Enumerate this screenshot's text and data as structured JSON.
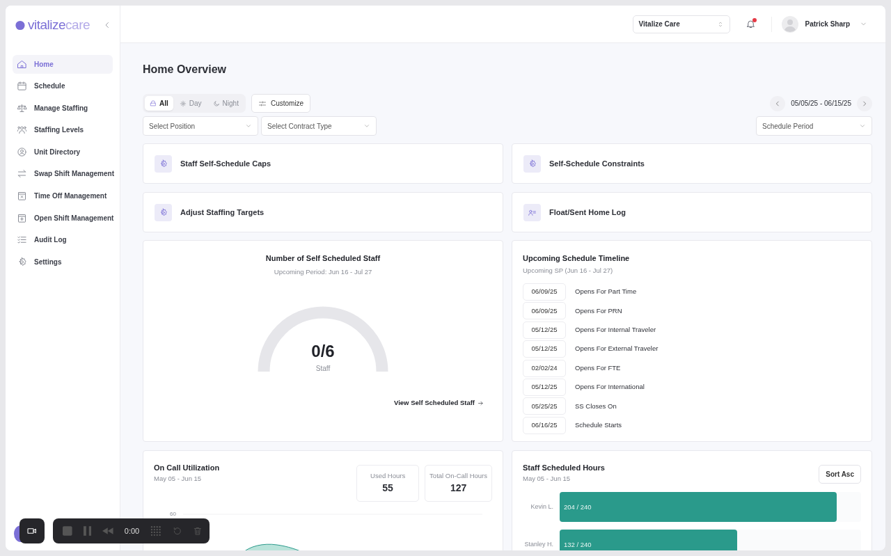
{
  "brand": {
    "name_part_1": "vitalize",
    "name_part_2": "care"
  },
  "sidebar": {
    "items": [
      {
        "label": "Home",
        "selected": true
      },
      {
        "label": "Schedule",
        "selected": false
      },
      {
        "label": "Manage Staffing",
        "selected": false
      },
      {
        "label": "Staffing Levels",
        "selected": false
      },
      {
        "label": "Unit Directory",
        "selected": false
      },
      {
        "label": "Swap Shift Management",
        "selected": false
      },
      {
        "label": "Time Off Management",
        "selected": false
      },
      {
        "label": "Open Shift Management",
        "selected": false
      },
      {
        "label": "Audit Log",
        "selected": false
      },
      {
        "label": "Settings",
        "selected": false
      }
    ]
  },
  "header": {
    "organization": "Vitalize Care",
    "notification_unread": true,
    "user_name": "Patrick Sharp"
  },
  "page_title": "Home Overview",
  "shift_tabs": [
    {
      "label": "All",
      "selected": true
    },
    {
      "label": "Day",
      "selected": false
    },
    {
      "label": "Night",
      "selected": false
    }
  ],
  "customize_button": "Customize",
  "date_range": "05/05/25 - 06/15/25",
  "filters": [
    {
      "placeholder": "Select Position"
    },
    {
      "placeholder": "Select Contract Type"
    }
  ],
  "period_filter": {
    "placeholder": "Schedule Period"
  },
  "quick_links": [
    {
      "label": "Staff Self-Schedule Caps",
      "kind": "gear"
    },
    {
      "label": "Self-Schedule Constraints",
      "kind": "gear"
    },
    {
      "label": "Adjust Staffing Targets",
      "kind": "gear"
    },
    {
      "label": "Float/Sent Home Log",
      "kind": "person"
    }
  ],
  "self_scheduled": {
    "title": "Number of Self Scheduled Staff",
    "subtitle": "Upcoming Period: Jun 16 - Jul 27",
    "value": "0/6",
    "unit": "Staff",
    "link": "View Self Scheduled Staff"
  },
  "timeline": {
    "title": "Upcoming Schedule Timeline",
    "subtitle": "Upcoming SP (Jun 16 - Jul 27)",
    "rows": [
      {
        "date": "06/09/25",
        "event": "Opens For Part Time"
      },
      {
        "date": "06/09/25",
        "event": "Opens For PRN"
      },
      {
        "date": "05/12/25",
        "event": "Opens For Internal Traveler"
      },
      {
        "date": "05/12/25",
        "event": "Opens For External Traveler"
      },
      {
        "date": "02/02/24",
        "event": "Opens For FTE"
      },
      {
        "date": "05/12/25",
        "event": "Opens For International"
      },
      {
        "date": "05/25/25",
        "event": "SS Closes On"
      },
      {
        "date": "06/16/25",
        "event": "Schedule Starts"
      }
    ]
  },
  "on_call": {
    "title": "On Call Utilization",
    "subtitle": "May 05 - Jun 15",
    "stats": [
      {
        "label": "Used Hours",
        "value": "55"
      },
      {
        "label": "Total On-Call Hours",
        "value": "127"
      }
    ],
    "axis_tick": "60"
  },
  "staff_hours": {
    "title": "Staff Scheduled Hours",
    "subtitle": "May 05 - Jun 15",
    "sort_button": "Sort Asc",
    "bars": [
      {
        "name": "Kevin L.",
        "label": "204 / 240",
        "level": 0.92
      },
      {
        "name": "Stanley H.",
        "label": "132 / 240",
        "level": 0.59
      }
    ]
  },
  "recorder": {
    "time": "0:00"
  }
}
